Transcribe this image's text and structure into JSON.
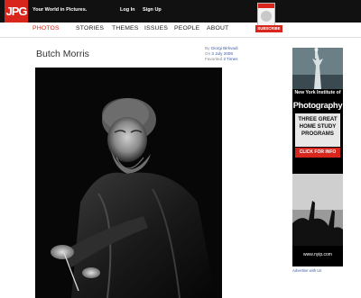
{
  "brand": {
    "logo": "JPG",
    "tagline": "Your World in Pictures.",
    "accent_color": "#d9261c"
  },
  "top_links": {
    "login": "Log In",
    "signup": "Sign Up"
  },
  "nav": {
    "items": [
      {
        "label": "PHOTOS",
        "active": true
      },
      {
        "label": "STORIES",
        "active": false
      },
      {
        "label": "THEMES",
        "active": false
      },
      {
        "label": "ISSUES",
        "active": false
      },
      {
        "label": "PEOPLE",
        "active": false
      },
      {
        "label": "ABOUT",
        "active": false
      }
    ]
  },
  "subscribe": {
    "label": "SUBSCRIBE"
  },
  "photo": {
    "title": "Butch Morris",
    "by_prefix": "By",
    "author": "Giorgi Birkvadi",
    "date_prefix": "On",
    "date": "3 July 2008",
    "favorited_prefix": "Favorited",
    "favorited_count": "2 Times"
  },
  "ad": {
    "institute": "New York Institute of",
    "photography": "Photography",
    "lines": [
      "THREE GREAT",
      "HOME STUDY",
      "PROGRAMS"
    ],
    "cta": "CLICK FOR INFO",
    "url": "www.nyip.com",
    "advertise_link": "Advertise with Us"
  }
}
